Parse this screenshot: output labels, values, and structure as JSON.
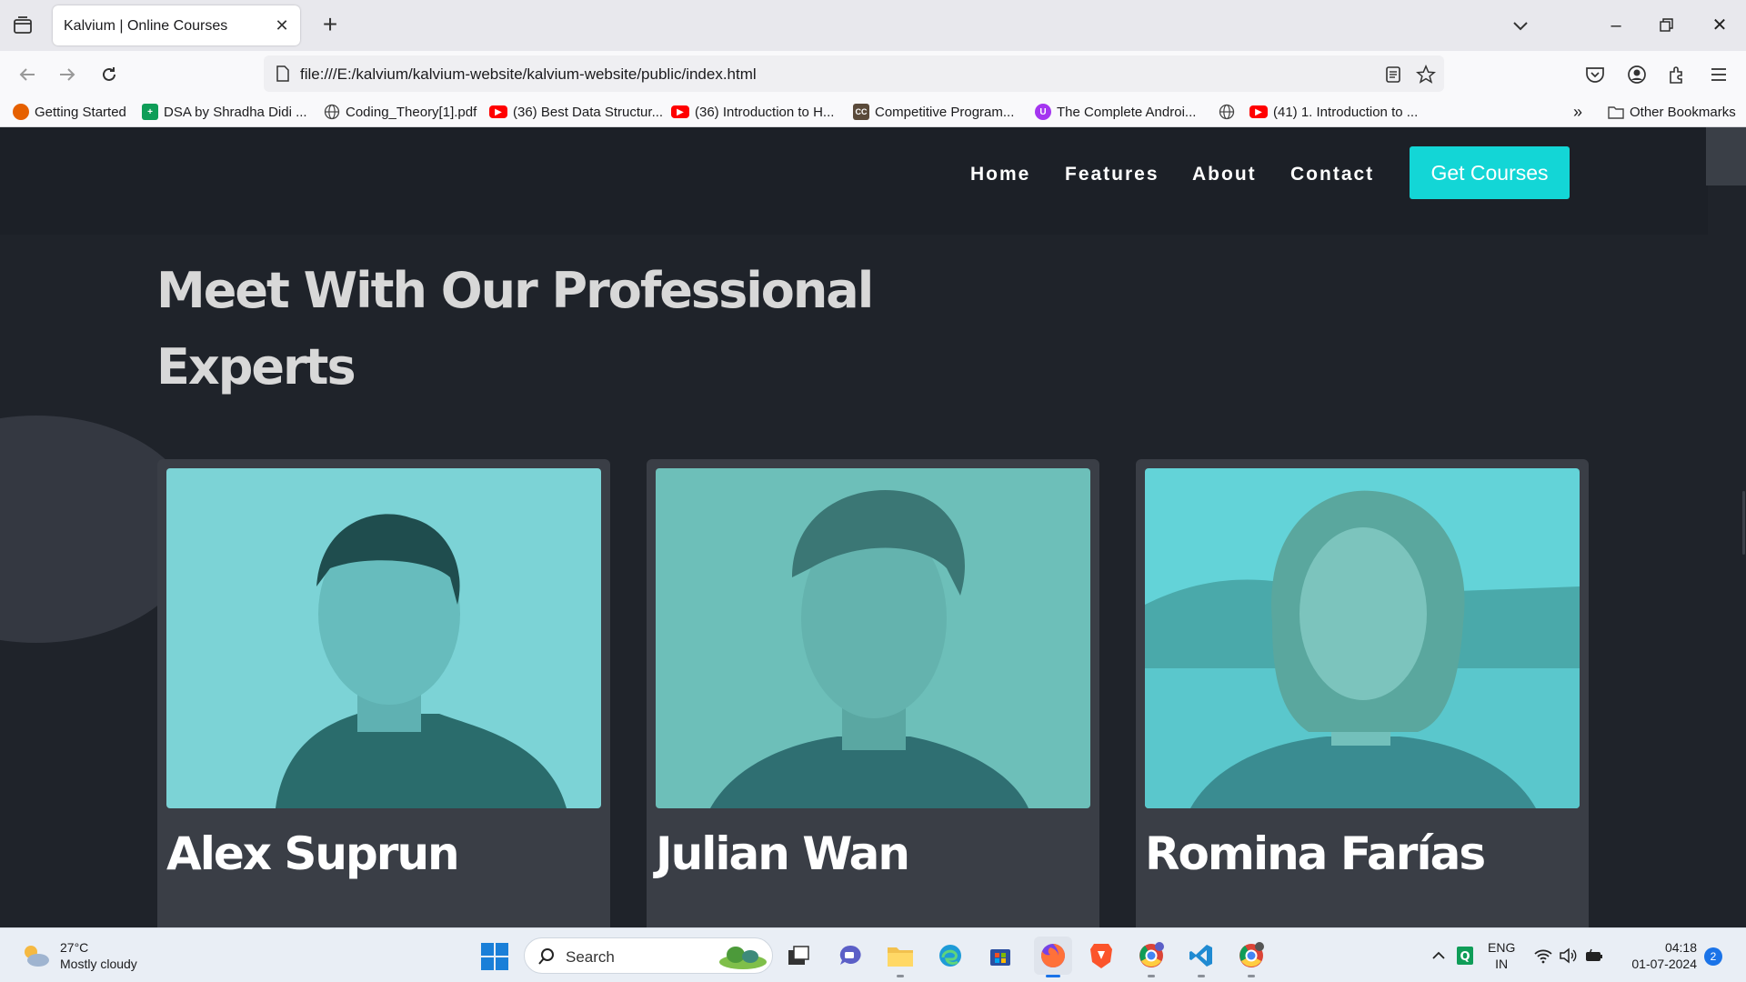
{
  "browser": {
    "tab_title": "Kalvium | Online Courses",
    "url": "file:///E:/kalvium/kalvium-website/kalvium-website/public/index.html",
    "bookmarks": [
      {
        "label": "Getting Started",
        "icon": "firefox-icon",
        "color": "#e66000"
      },
      {
        "label": "DSA by Shradha Didi ...",
        "icon": "sheets-icon",
        "color": "#0f9d58"
      },
      {
        "label": "Coding_Theory[1].pdf",
        "icon": "globe-icon",
        "color": "#555555"
      },
      {
        "label": "(36) Best Data Structur...",
        "icon": "youtube-icon",
        "color": "#ff0000"
      },
      {
        "label": "(36) Introduction to H...",
        "icon": "youtube-icon",
        "color": "#ff0000"
      },
      {
        "label": "Competitive Program...",
        "icon": "cc-icon",
        "color": "#5a4a3a"
      },
      {
        "label": "The Complete Androi...",
        "icon": "udemy-icon",
        "color": "#a435f0"
      },
      {
        "label": "",
        "icon": "globe-icon",
        "color": "#555555"
      },
      {
        "label": "(41) 1. Introduction to ...",
        "icon": "youtube-icon",
        "color": "#ff0000"
      }
    ],
    "other_bookmarks": "Other Bookmarks"
  },
  "site": {
    "nav": [
      "Home",
      "Features",
      "About",
      "Contact"
    ],
    "cta": "Get Courses",
    "accent": "#13d6d6",
    "heading_line1": "Meet With Our Professional",
    "heading_line2": "Experts",
    "experts": [
      {
        "name": "Alex Suprun"
      },
      {
        "name": "Julian Wan"
      },
      {
        "name": "Romina Farías"
      }
    ]
  },
  "taskbar": {
    "temperature": "27°C",
    "weather": "Mostly cloudy",
    "search": "Search",
    "lang1": "ENG",
    "lang2": "IN",
    "time": "04:18",
    "date": "01-07-2024",
    "notifications": "2"
  }
}
